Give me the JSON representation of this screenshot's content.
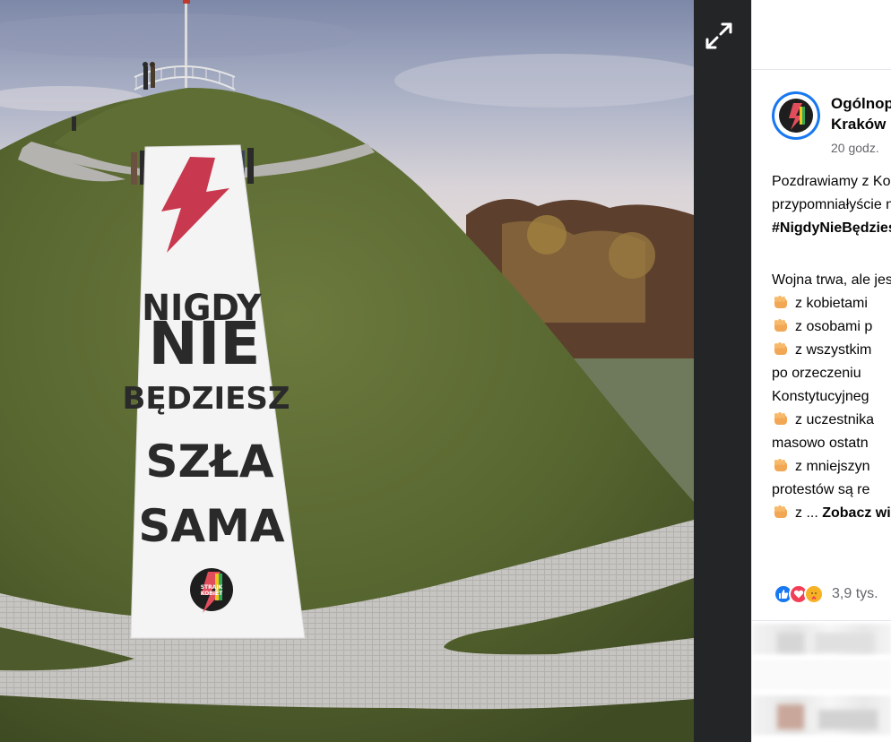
{
  "photo": {
    "banner": {
      "line1": "NIGDY",
      "line2": "NIE",
      "line3": "BĘDZIESZ",
      "line4": "SZŁA",
      "line5": "SAMA",
      "logo_text_1": "STRAJK",
      "logo_text_2": "KOBIET"
    }
  },
  "viewer": {
    "expand_icon": "expand-arrows-icon"
  },
  "post": {
    "page_name_line1": "Ogólnopolski Strajk Kobiet",
    "page_name_line2": "Kraków",
    "timestamp": "20 godz.",
    "text_line1": "Pozdrawiamy z Kopca Kościuszki",
    "text_line2": "przypomniałyście nam",
    "hashtag": "#NigdyNieBędzieszSzłaSama",
    "text_line4": "Wojna trwa, ale jesteśmy razem",
    "fist_items": [
      "z kobietami",
      "z osobami p",
      "z wszystkim"
    ],
    "text_cont1": "po orzeczeniu",
    "text_cont2": "Konstytucyjneg",
    "fist_item4": "z uczestnika",
    "text_cont3": "masowo ostatn",
    "fist_item5": "z mniejszyn",
    "text_cont4": "protestów są re",
    "fist_item6_prefix": "z ...",
    "see_more": "Zobacz więcej",
    "reaction_icons": [
      "like-icon",
      "love-icon",
      "care-icon"
    ],
    "reaction_count": "3,9 tys."
  },
  "colors": {
    "facebook_blue": "#1877f2",
    "love_red": "#f33e58",
    "care_yellow": "#f7b125",
    "banner_bolt": "#c8384e"
  }
}
